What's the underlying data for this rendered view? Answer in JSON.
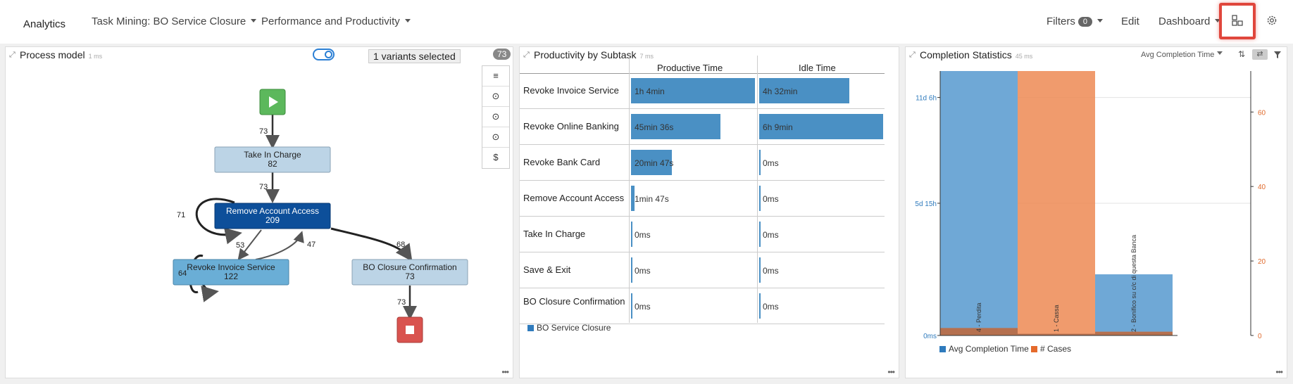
{
  "topbar": {
    "title": "Analytics",
    "process_menu": "Task Mining: BO Service Closure",
    "view_menu": "Performance and Productivity",
    "filters_label": "Filters",
    "filters_count": "0",
    "edit_label": "Edit",
    "dashboard_label": "Dashboard"
  },
  "process_model": {
    "title": "Process model",
    "time": "1 ms",
    "variants_selected": "1 variants selected",
    "count": "73",
    "tools": [
      "≡",
      "⊙",
      "⊙",
      "⊙",
      "$"
    ],
    "nodes": [
      {
        "name": "Take In Charge",
        "count": "82"
      },
      {
        "name": "Remove Account Access",
        "count": "209"
      },
      {
        "name": "Revoke Invoice Service",
        "count": "122"
      },
      {
        "name": "BO Closure Confirmation",
        "count": "73"
      }
    ],
    "edge_labels": [
      "73",
      "73",
      "71",
      "53",
      "47",
      "68",
      "64",
      "73"
    ]
  },
  "productivity": {
    "title": "Productivity by Subtask",
    "time": "7 ms",
    "col_productive": "Productive Time",
    "col_idle": "Idle Time",
    "rows": [
      {
        "label": "Revoke Invoice Service",
        "productive": "1h 4min",
        "idle": "4h 32min",
        "p_frac": 1.0,
        "i_frac": 0.73
      },
      {
        "label": "Revoke Online Banking",
        "productive": "45min 36s",
        "idle": "6h 9min",
        "p_frac": 0.72,
        "i_frac": 1.0
      },
      {
        "label": "Revoke Bank Card",
        "productive": "20min 47s",
        "idle": "0ms",
        "p_frac": 0.33,
        "i_frac": 0.0
      },
      {
        "label": "Remove Account Access",
        "productive": "1min 47s",
        "idle": "0ms",
        "p_frac": 0.03,
        "i_frac": 0.0
      },
      {
        "label": "Take In Charge",
        "productive": "0ms",
        "idle": "0ms",
        "p_frac": 0.0,
        "i_frac": 0.0
      },
      {
        "label": "Save & Exit",
        "productive": "0ms",
        "idle": "0ms",
        "p_frac": 0.0,
        "i_frac": 0.0
      },
      {
        "label": "BO Closure Confirmation",
        "productive": "0ms",
        "idle": "0ms",
        "p_frac": 0.0,
        "i_frac": 0.0
      }
    ],
    "legend": "BO Service Closure",
    "colors": {
      "bar": "#4a90c4",
      "legend": "#2f7bbd"
    }
  },
  "completion": {
    "title": "Completion Statistics",
    "time": "45 ms",
    "metric_dropdown": "Avg Completion Time",
    "legend_avg": "Avg Completion Time",
    "legend_cases": "# Cases",
    "colors": {
      "avg": "#6fa8d6",
      "cases": "#ed8a54",
      "overlap": "#b5704f"
    }
  },
  "chart_data": {
    "type": "bar",
    "categories": [
      "4 - Perdita",
      "1 - Cassa",
      "2 - Bonifico su c/c di questa Banca"
    ],
    "series": [
      {
        "name": "Avg Completion Time",
        "axis": "left",
        "values_days": [
          16.0,
          0.1,
          3.7
        ]
      },
      {
        "name": "# Cases",
        "axis": "right",
        "values": [
          2,
          71,
          1
        ]
      }
    ],
    "left_ticks": [
      "0ms",
      "5d 15h",
      "11d 6h"
    ],
    "right_ticks": [
      "0",
      "20",
      "40",
      "60"
    ],
    "right_ylim": [
      0,
      71
    ]
  }
}
